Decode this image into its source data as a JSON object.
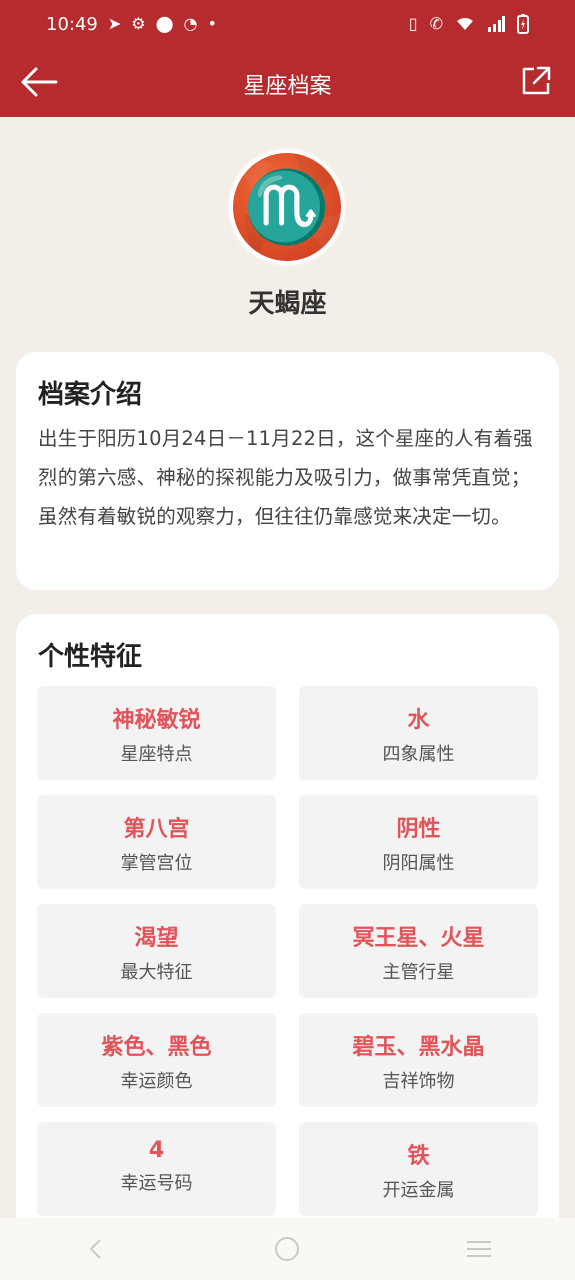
{
  "status_bar": {
    "time": "10:49",
    "left_icons": [
      "telegram-icon",
      "gear-icon",
      "location-icon",
      "speed-icon",
      "dot-icon"
    ],
    "right_icons": [
      "vibrate-icon",
      "wifi-call-icon",
      "wifi-icon",
      "signal-icon",
      "battery-icon"
    ]
  },
  "navbar": {
    "title": "星座档案",
    "back_icon": "arrow-left-icon",
    "share_icon": "share-external-icon"
  },
  "profile": {
    "symbol": "♏",
    "name": "天蝎座"
  },
  "intro": {
    "title": "档案介绍",
    "text": "出生于阳历10月24日－11月22日，这个星座的人有着强烈的第六感、神秘的探视能力及吸引力，做事常凭直觉；虽然有着敏锐的观察力，但往往仍靠感觉来决定一切。"
  },
  "traits": {
    "title": "个性特征",
    "items": [
      {
        "value": "神秘敏锐",
        "label": "星座特点"
      },
      {
        "value": "水",
        "label": "四象属性"
      },
      {
        "value": "第八宫",
        "label": "掌管宫位"
      },
      {
        "value": "阴性",
        "label": "阴阳属性"
      },
      {
        "value": "渴望",
        "label": "最大特征"
      },
      {
        "value": "冥王星、火星",
        "label": "主管行星"
      },
      {
        "value": "紫色、黑色",
        "label": "幸运颜色"
      },
      {
        "value": "碧玉、黑水晶",
        "label": "吉祥饰物"
      },
      {
        "value": "4",
        "label": "幸运号码"
      },
      {
        "value": "铁",
        "label": "开运金属"
      }
    ]
  },
  "system_nav": {
    "back_icon": "system-back-icon",
    "home_icon": "system-home-icon",
    "recents_icon": "system-menu-icon"
  },
  "colors": {
    "header": "#b52b2e",
    "accent": "#e0545a",
    "background": "#f3eee7"
  }
}
